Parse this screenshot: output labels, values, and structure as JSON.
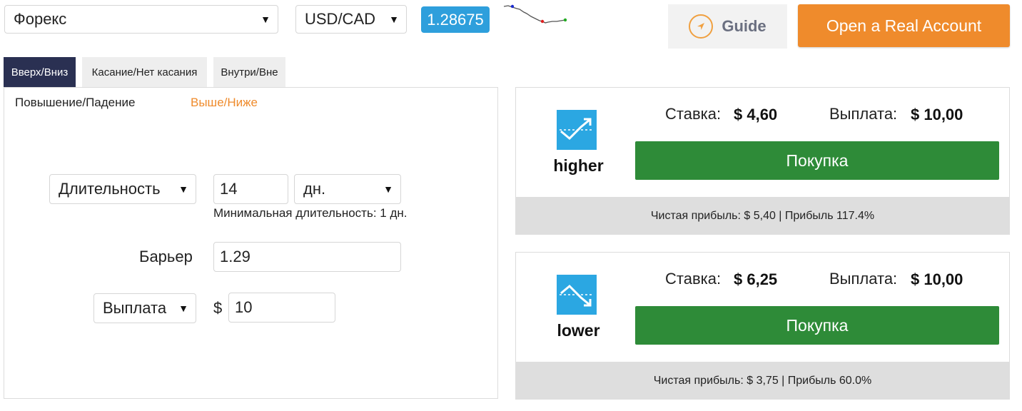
{
  "header": {
    "market": "Форекс",
    "symbol": "USD/CAD",
    "spot_price": "1.28675",
    "guide_label": "Guide",
    "open_account_label": "Open a Real Account"
  },
  "tabs": [
    {
      "label": "Вверх/Вниз",
      "active": true
    },
    {
      "label": "Касание/Нет касания",
      "active": false
    },
    {
      "label": "Внутри/Вне",
      "active": false
    }
  ],
  "subtabs": [
    {
      "label": "Повышение/Падение",
      "active": false
    },
    {
      "label": "Выше/Ниже",
      "active": true
    }
  ],
  "form": {
    "duration_type": "Длительность",
    "duration_value": "14",
    "duration_unit": "дн.",
    "min_duration_note": "Минимальная длительность: 1 дн.",
    "barrier_label": "Барьер",
    "barrier_value": "1.29",
    "basis": "Выплата",
    "currency_symbol": "$",
    "amount": "10"
  },
  "contracts": [
    {
      "type_label": "higher",
      "icon": "trend-up-icon",
      "stake_label": "Ставка:",
      "stake_value": "$ 4,60",
      "payout_label": "Выплата:",
      "payout_value": "$ 10,00",
      "buy_label": "Покупка",
      "profit_text": "Чистая прибыль: $ 5,40 | Прибыль 117.4%"
    },
    {
      "type_label": "lower",
      "icon": "trend-down-icon",
      "stake_label": "Ставка:",
      "stake_value": "$ 6,25",
      "payout_label": "Выплата:",
      "payout_value": "$ 10,00",
      "buy_label": "Покупка",
      "profit_text": "Чистая прибыль: $ 3,75 | Прибыль 60.0%"
    }
  ],
  "colors": {
    "accent_orange": "#ef8b2c",
    "price_blue": "#2e9fdc",
    "buy_green": "#2e8b38",
    "active_tab": "#2a3052",
    "contract_icon_blue": "#2ba7e2"
  }
}
